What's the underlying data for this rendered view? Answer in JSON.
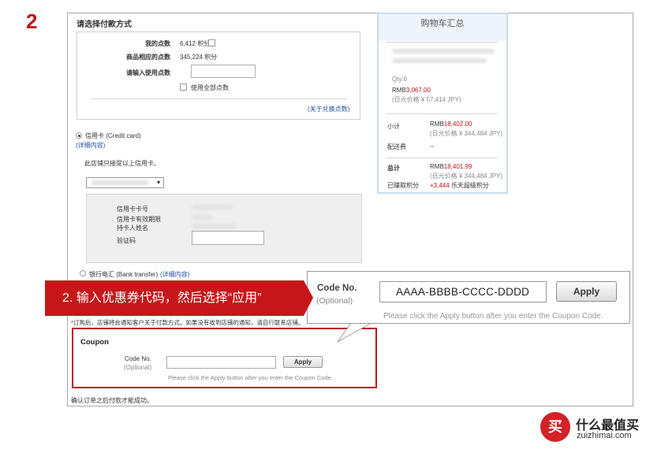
{
  "step_number": "2",
  "payment": {
    "section_title": "请选择付款方式",
    "points": {
      "my_points_label": "我的点数",
      "my_points_value": "6,412 积分",
      "order_points_label": "商品相应的点数",
      "order_points_value": "345,224 积分",
      "use_points_label": "请输入使用点数",
      "use_all_label": "使用全部点数",
      "exchange_link": "(关于兑换点数)"
    },
    "credit_card": {
      "label": "信用卡 (Credit card)",
      "detail_link": "(详细内容)",
      "accepted_note": "此店铺只接受以上信用卡。",
      "card_number_label": "信用卡卡号",
      "expiry_label": "信用卡有效期限",
      "holder_label": "持卡人姓名",
      "cvv_label": "验证码"
    },
    "bank_transfer": {
      "label": "银行电汇 (Bank transfer)",
      "detail_link": "(详细内容)"
    },
    "notice": "*订购后，店铺将会通知客户关于付款方式。如果没有收到店铺的通知，请自行联系店铺。",
    "footer_note": "确认订单之后付款才能成功。"
  },
  "cart": {
    "title": "购物车汇总",
    "qty": "Qty:6",
    "item_price_prefix": "RMB",
    "item_price": "3,067.00",
    "item_jpy": "(日元价格 ¥ 57,414 JPY)",
    "subtotal_label": "小计",
    "subtotal_prefix": "RMB",
    "subtotal": "18,402.00",
    "subtotal_jpy": "(日元价格 ¥ 344,484 JPY)",
    "shipping_label": "配送费",
    "shipping_value": "--",
    "total_label": "总计",
    "total_prefix": "RMB",
    "total": "18,401.99",
    "total_jpy": "(日元价格 ¥ 344,484 JPY)",
    "earned_label": "已赚取积分",
    "earned_value": "+3,444",
    "earned_suffix": "乐天超级积分"
  },
  "coupon": {
    "title": "Coupon",
    "code_label": "Code No.",
    "optional": "(Optional)",
    "apply": "Apply",
    "hint": "Please click the Apply button after you enter the Coupon Code."
  },
  "annotation": {
    "banner": "2. 输入优惠券代码，然后选择“应用”",
    "code_label": "Code No.",
    "optional": "(Optional)",
    "code_value": "AAAA-BBBB-CCCC-DDDD",
    "apply": "Apply",
    "hint": "Please click the Apply button after you enter the Coupon Code."
  },
  "watermark": {
    "badge": "买",
    "title": "什么最值买",
    "domain": "zuizhimai.com"
  },
  "colors": {
    "accent_red": "#c71619",
    "link_blue": "#1f4e9c",
    "cart_border": "#c7dced"
  }
}
